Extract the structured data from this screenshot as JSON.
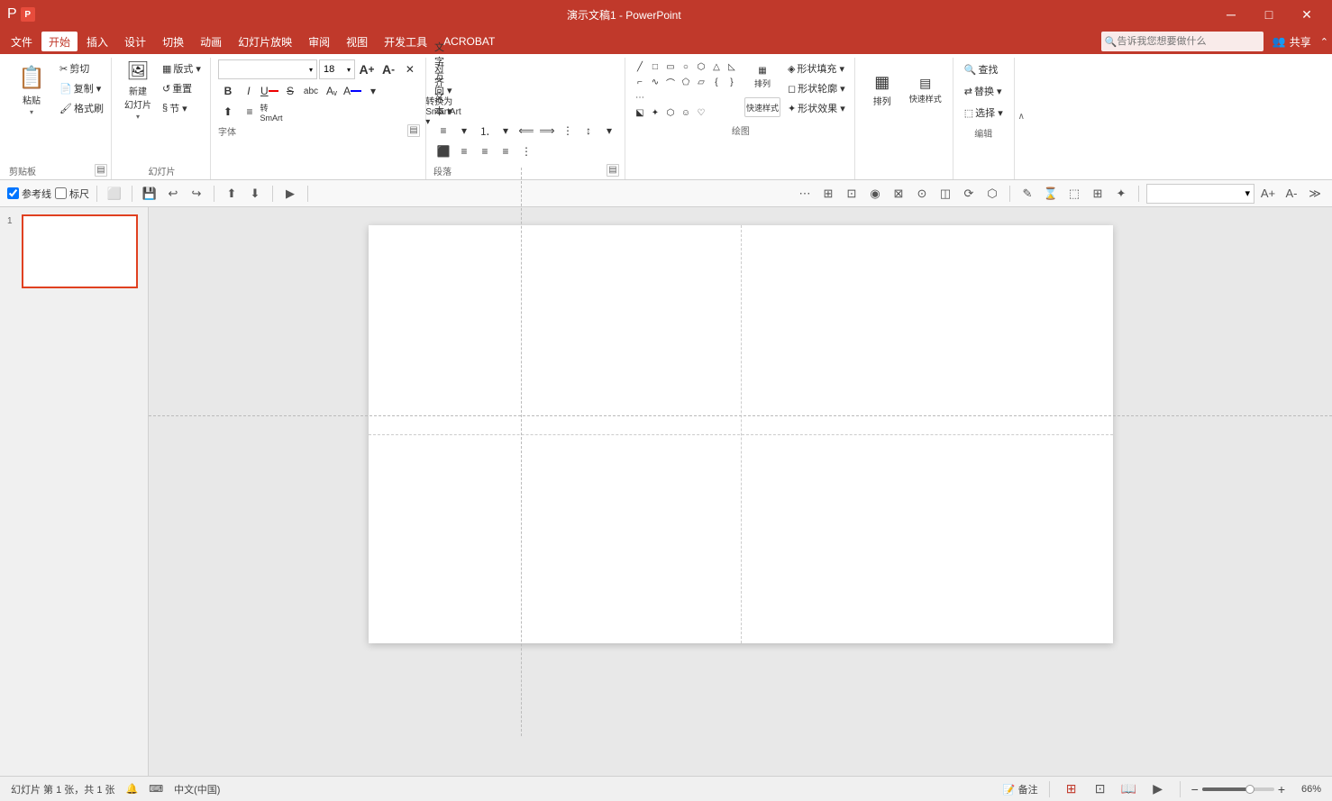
{
  "titleBar": {
    "title": "演示文稿1 - PowerPoint",
    "winButtons": [
      "─",
      "□",
      "✕"
    ]
  },
  "menuBar": {
    "items": [
      "文件",
      "开始",
      "插入",
      "设计",
      "切换",
      "动画",
      "幻灯片放映",
      "审阅",
      "视图",
      "开发工具",
      "ACROBAT"
    ],
    "activeItem": "开始",
    "search": "告诉我您想要做什么",
    "share": "共享"
  },
  "ribbon": {
    "groups": [
      {
        "id": "clipboard",
        "label": "剪贴板",
        "buttons": [
          {
            "id": "paste",
            "label": "粘贴",
            "icon": "📋"
          },
          {
            "id": "cut",
            "label": "剪切",
            "icon": "✂"
          },
          {
            "id": "copy",
            "label": "复制",
            "icon": "📄"
          },
          {
            "id": "format-painter",
            "label": "格式刷",
            "icon": "🖌"
          }
        ]
      },
      {
        "id": "slides",
        "label": "幻灯片",
        "buttons": [
          {
            "id": "new-slide",
            "label": "新建\n幻灯片",
            "icon": "🖼"
          },
          {
            "id": "layout",
            "label": "版式▾",
            "icon": ""
          },
          {
            "id": "reset",
            "label": "重置",
            "icon": ""
          },
          {
            "id": "section",
            "label": "节▾",
            "icon": ""
          }
        ]
      },
      {
        "id": "font",
        "label": "字体",
        "fontName": "",
        "fontSize": "18",
        "formatButtons": [
          "B",
          "I",
          "U",
          "S",
          "abc",
          "Aa",
          "A",
          "A"
        ]
      },
      {
        "id": "paragraph",
        "label": "段落"
      },
      {
        "id": "drawing",
        "label": "绘图"
      },
      {
        "id": "arrange",
        "label": "排列",
        "buttons": [
          {
            "id": "arrange-btn",
            "label": "排列",
            "icon": "▦"
          }
        ]
      },
      {
        "id": "quick-styles",
        "label": "快速样式"
      },
      {
        "id": "shape-effects",
        "label": "形状效果▾",
        "buttons": [
          {
            "id": "shape-fill",
            "label": "形状填充▾"
          },
          {
            "id": "shape-outline",
            "label": "形状轮廓▾"
          },
          {
            "id": "shape-effect",
            "label": "形状效果▾"
          }
        ]
      },
      {
        "id": "editing",
        "label": "编辑",
        "buttons": [
          {
            "id": "find",
            "label": "查找"
          },
          {
            "id": "replace",
            "label": "替换▾"
          },
          {
            "id": "select",
            "label": "选择▾"
          }
        ]
      }
    ]
  },
  "quickAccess": {
    "checkboxes": [
      {
        "id": "ref-line",
        "label": "参考线",
        "checked": true
      },
      {
        "id": "ruler",
        "label": "标尺",
        "checked": false
      }
    ],
    "buttons": [
      "💾",
      "↩",
      "↪",
      "⬆",
      "⬇",
      "▶"
    ]
  },
  "slidesPanel": {
    "slides": [
      {
        "number": "1",
        "selected": true
      }
    ]
  },
  "statusBar": {
    "slideInfo": "幻灯片 第 1 张，共 1 张",
    "language": "中文(中国)",
    "notes": "备注",
    "zoomLevel": "66%",
    "viewButtons": [
      "普通",
      "幻灯片浏览",
      "阅读视图"
    ]
  }
}
